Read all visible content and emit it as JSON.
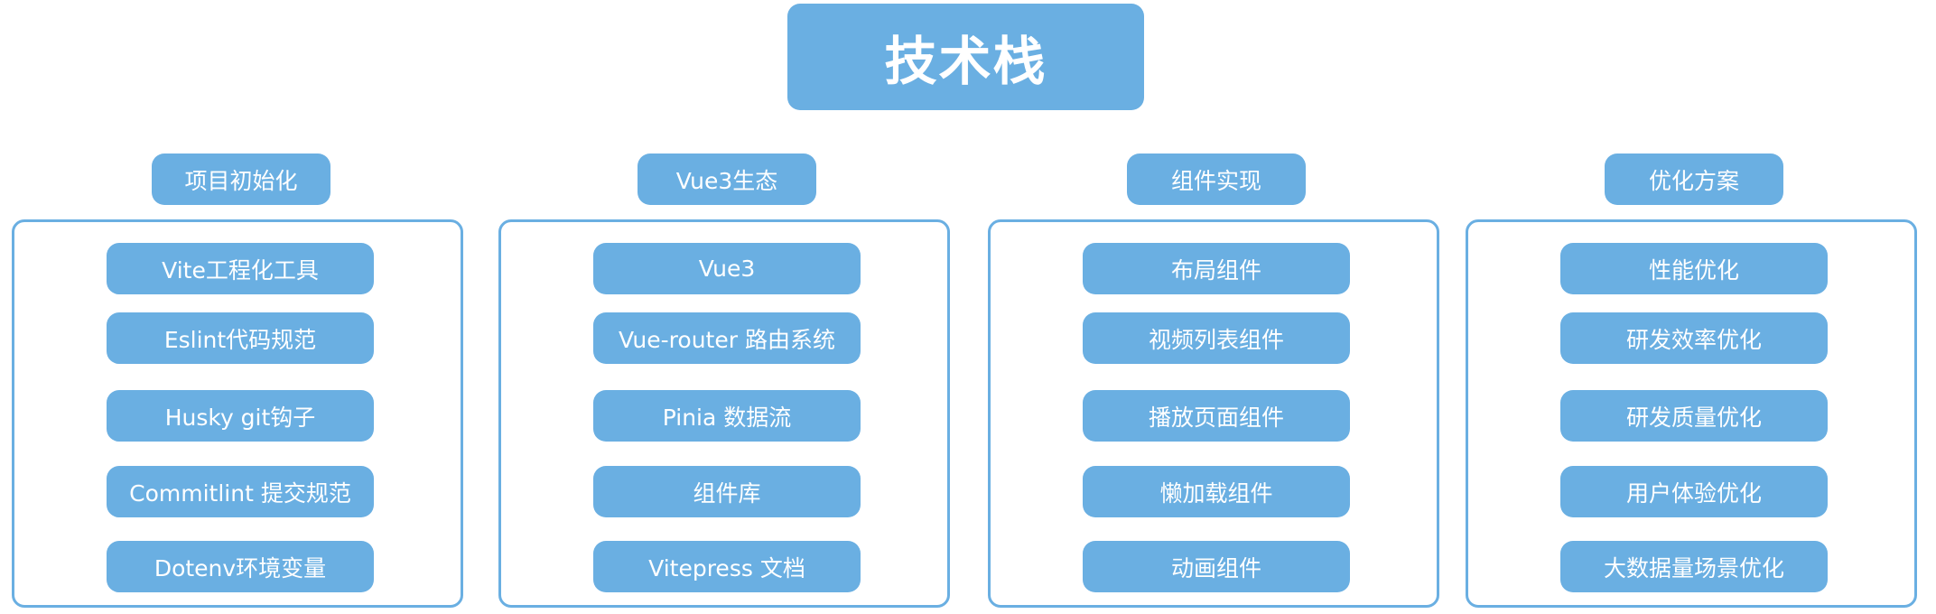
{
  "title": "技术栈",
  "colors": {
    "node_fill": "#6aafe2",
    "node_text": "#ffffff",
    "box_border": "#6aafe2",
    "background": "#ffffff"
  },
  "categories": [
    {
      "label": "项目初始化",
      "items": [
        "Vite工程化工具",
        "Eslint代码规范",
        "Husky git钩子",
        "Commitlint 提交规范",
        "Dotenv环境变量"
      ]
    },
    {
      "label": "Vue3生态",
      "items": [
        "Vue3",
        "Vue-router 路由系统",
        "Pinia 数据流",
        "组件库",
        "Vitepress 文档"
      ]
    },
    {
      "label": "组件实现",
      "items": [
        "布局组件",
        "视频列表组件",
        "播放页面组件",
        "懒加载组件",
        "动画组件"
      ]
    },
    {
      "label": "优化方案",
      "items": [
        "性能优化",
        "研发效率优化",
        "研发质量优化",
        "用户体验优化",
        "大数据量场景优化"
      ]
    }
  ]
}
